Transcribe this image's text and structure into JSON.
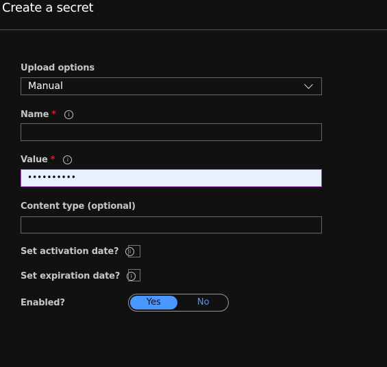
{
  "title": "Create a secret",
  "upload": {
    "label": "Upload options",
    "value": "Manual"
  },
  "name": {
    "label": "Name",
    "required": "*",
    "value": ""
  },
  "value": {
    "label": "Value",
    "required": "*",
    "value": "••••••••••"
  },
  "content_type": {
    "label": "Content type (optional)",
    "value": ""
  },
  "activation": {
    "label": "Set activation date?",
    "checked": false
  },
  "expiration": {
    "label": "Set expiration date?",
    "checked": false
  },
  "enabled": {
    "label": "Enabled?",
    "yes": "Yes",
    "no": "No",
    "selected": "Yes"
  },
  "info_glyph": "i",
  "colors": {
    "accent": "#4a98ff",
    "required": "#e81123",
    "focus_border": "#a74fc6"
  }
}
